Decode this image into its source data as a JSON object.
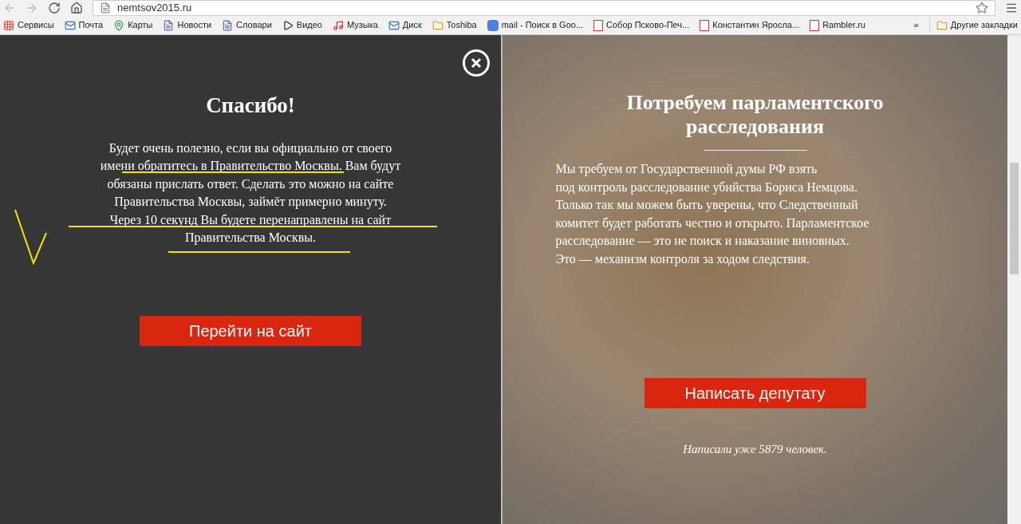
{
  "browser": {
    "address": "nemtsov2015.ru",
    "bookmarks": [
      {
        "label": "Сервисы",
        "kind": "apps"
      },
      {
        "label": "Почта",
        "kind": "mail"
      },
      {
        "label": "Карты",
        "kind": "maps"
      },
      {
        "label": "Новости",
        "kind": "doc"
      },
      {
        "label": "Словари",
        "kind": "doc"
      },
      {
        "label": "Видео",
        "kind": "video"
      },
      {
        "label": "Музыка",
        "kind": "music"
      },
      {
        "label": "Диск",
        "kind": "mail"
      },
      {
        "label": "Toshiba",
        "kind": "folder"
      },
      {
        "label": "mail - Поиск в Goo...",
        "kind": "google"
      },
      {
        "label": "Собор Псково-Печ...",
        "kind": "yandex"
      },
      {
        "label": "Константин Яросла...",
        "kind": "yandex"
      },
      {
        "label": "Rambler.ru",
        "kind": "yandex"
      }
    ],
    "overflow": "»",
    "other_bookmarks": "Другие закладки"
  },
  "left_panel": {
    "title": "Спасибо!",
    "paragraph_lines": [
      "Будет очень полезно, если вы официально от своего",
      "имени обратитесь в Правительство Москвы. Вам будут",
      "обязаны прислать ответ. Сделать это можно на сайте",
      "Правительства Москвы, займёт примерно минуту.",
      "Через 10 секунд Вы будете перенаправлены на сайт",
      "Правительства Москвы."
    ],
    "button": "Перейти на сайт"
  },
  "right_panel": {
    "title_lines": [
      "Потребуем парламентского",
      "расследования"
    ],
    "paragraph_lines": [
      "Мы требуем от Государственной думы РФ взять",
      "под контроль расследование убийства Бориса Немцова.",
      "Только так мы можем быть уверены, что Следственный",
      "комитет будет работать честно и открыто. Парламентское",
      "расследование — это не поиск и наказание виновных.",
      "Это — механизм контроля за ходом следствия."
    ],
    "button": "Написать депутату",
    "counter": "Написали уже 5879 человек."
  }
}
